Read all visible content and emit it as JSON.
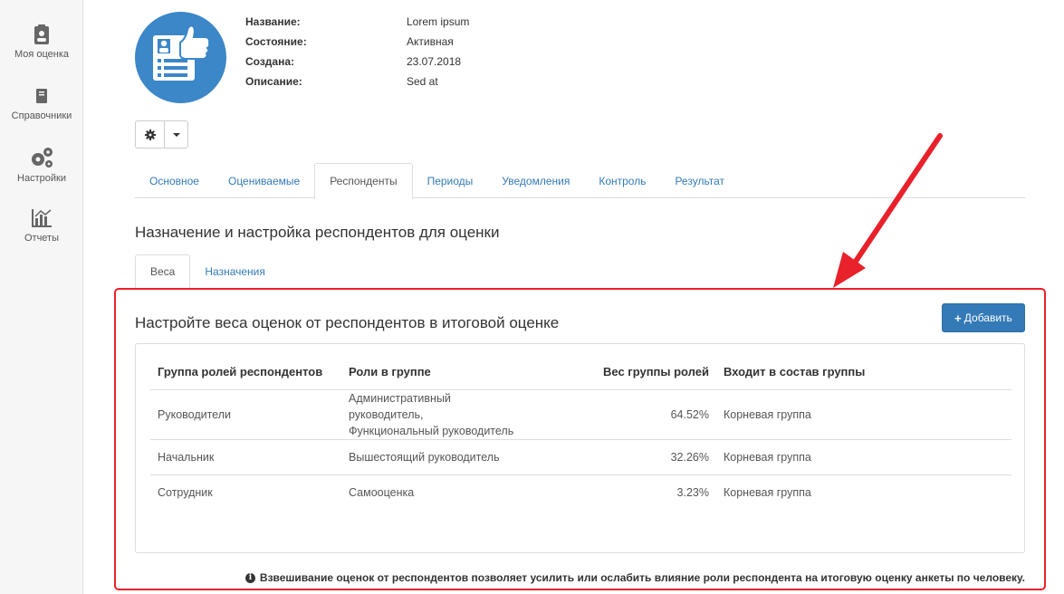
{
  "sidebar": {
    "items": [
      {
        "label": "Моя оценка",
        "icon": "clipboard-user-icon"
      },
      {
        "label": "Справочники",
        "icon": "book-icon"
      },
      {
        "label": "Настройки",
        "icon": "gears-icon"
      },
      {
        "label": "Отчеты",
        "icon": "chart-icon"
      }
    ]
  },
  "info": {
    "rows": [
      {
        "key": "Название:",
        "value": "Lorem ipsum"
      },
      {
        "key": "Состояние:",
        "value": "Активная"
      },
      {
        "key": "Создана:",
        "value": "23.07.2018"
      },
      {
        "key": "Описание:",
        "value": "Sed at"
      }
    ]
  },
  "tabs": [
    {
      "label": "Основное",
      "active": false
    },
    {
      "label": "Оцениваемые",
      "active": false
    },
    {
      "label": "Респонденты",
      "active": true
    },
    {
      "label": "Периоды",
      "active": false
    },
    {
      "label": "Уведомления",
      "active": false
    },
    {
      "label": "Контроль",
      "active": false
    },
    {
      "label": "Результат",
      "active": false
    }
  ],
  "section_title": "Назначение и настройка респондентов для оценки",
  "subtabs": [
    {
      "label": "Веса",
      "active": true
    },
    {
      "label": "Назначения",
      "active": false
    }
  ],
  "panel": {
    "title": "Настройте веса оценок от респондентов в итоговой оценке",
    "add_label": "Добавить",
    "columns": [
      "Группа ролей респондентов",
      "Роли в группе",
      "Вес группы ролей",
      "Входит в состав группы"
    ],
    "rows": [
      {
        "group": "Руководители",
        "roles_line1": "Административный руководитель,",
        "roles_line2": "Функциональный руководитель",
        "weight": "64.52%",
        "parent": "Корневая группа"
      },
      {
        "group": "Начальник",
        "roles_line1": "Вышестоящий руководитель",
        "roles_line2": "",
        "weight": "32.26%",
        "parent": "Корневая группа"
      },
      {
        "group": "Сотрудник",
        "roles_line1": "Самооценка",
        "roles_line2": "",
        "weight": "3.23%",
        "parent": "Корневая группа"
      }
    ]
  },
  "note": "Взвешивание оценок от респондентов позволяет усилить или ослабить влияние роли респондента на итоговую оценку анкеты по человеку.",
  "colors": {
    "accent": "#337ab7",
    "highlight": "#e8212a",
    "avatar_bg": "#3b87c8"
  }
}
